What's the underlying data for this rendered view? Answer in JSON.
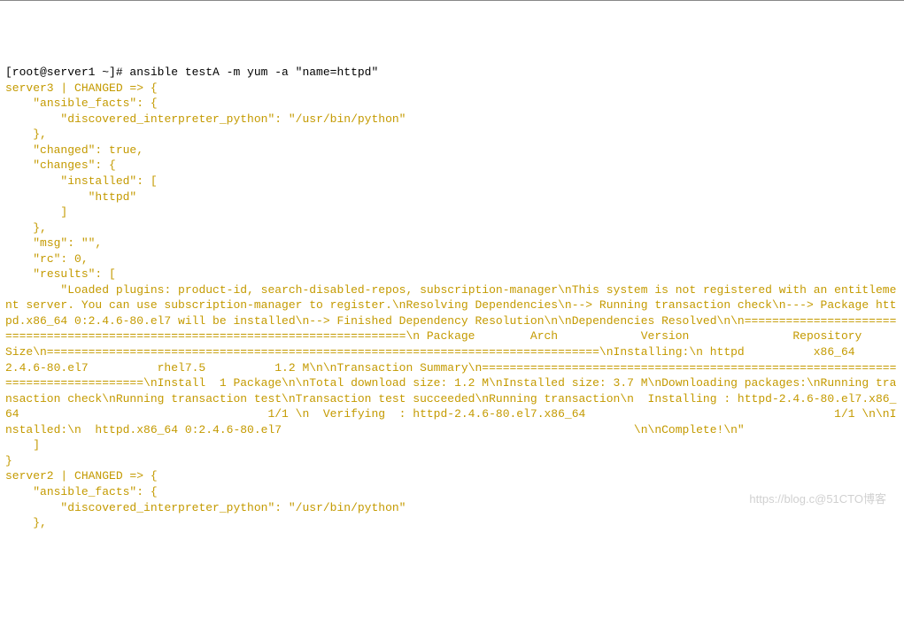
{
  "prompt": "[root@server1 ~]# ansible testA -m yum -a \"name=httpd\"",
  "output": {
    "lines": [
      "server3 | CHANGED => {",
      "    \"ansible_facts\": {",
      "        \"discovered_interpreter_python\": \"/usr/bin/python\"",
      "    },",
      "    \"changed\": true,",
      "    \"changes\": {",
      "        \"installed\": [",
      "            \"httpd\"",
      "        ]",
      "    },",
      "    \"msg\": \"\",",
      "    \"rc\": 0,",
      "    \"results\": [",
      "        \"Loaded plugins: product-id, search-disabled-repos, subscription-manager\\nThis system is not registered with an entitlement server. You can use subscription-manager to register.\\nResolving Dependencies\\n--> Running transaction check\\n---> Package httpd.x86_64 0:2.4.6-80.el7 will be installed\\n--> Finished Dependency Resolution\\n\\nDependencies Resolved\\n\\n================================================================================\\n Package        Arch            Version               Repository        Size\\n================================================================================\\nInstalling:\\n httpd          x86_64          2.4.6-80.el7          rhel7.5          1.2 M\\n\\nTransaction Summary\\n================================================================================\\nInstall  1 Package\\n\\nTotal download size: 1.2 M\\nInstalled size: 3.7 M\\nDownloading packages:\\nRunning transaction check\\nRunning transaction test\\nTransaction test succeeded\\nRunning transaction\\n  Installing : httpd-2.4.6-80.el7.x86_64                                    1/1 \\n  Verifying  : httpd-2.4.6-80.el7.x86_64                                    1/1 \\n\\nInstalled:\\n  httpd.x86_64 0:2.4.6-80.el7                                                   \\n\\nComplete!\\n\"",
      "    ]",
      "}",
      "server2 | CHANGED => {",
      "    \"ansible_facts\": {",
      "        \"discovered_interpreter_python\": \"/usr/bin/python\"",
      "    },"
    ]
  },
  "watermark": "https://blog.c@51CTO博客"
}
